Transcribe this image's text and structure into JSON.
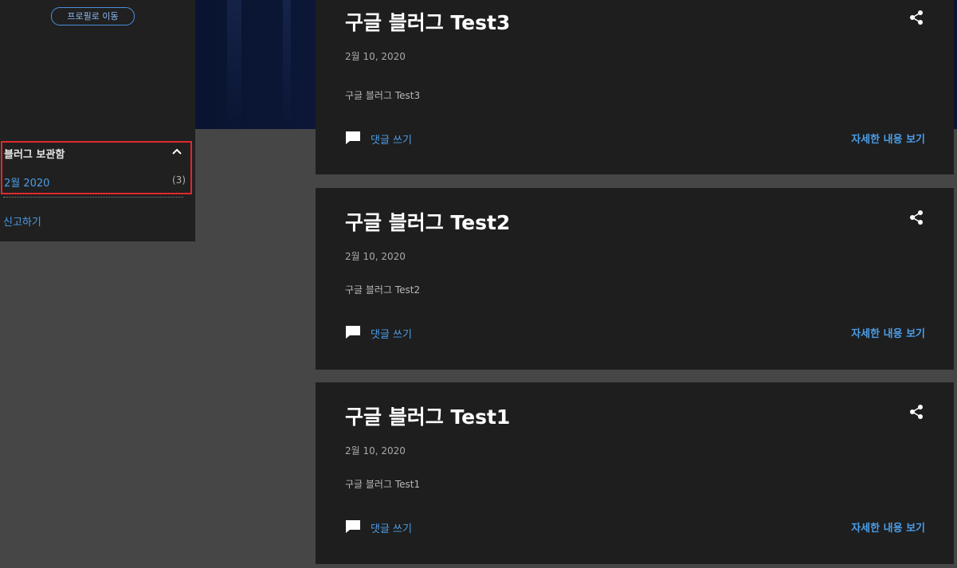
{
  "sidebar": {
    "profile_button": "프로필로 이동",
    "archive": {
      "title": "블러그 보관함",
      "month_link": "2월 2020",
      "count": "(3)"
    },
    "report_link": "신고하기"
  },
  "posts": [
    {
      "title": "구글 블러그 Test3",
      "date": "2월 10, 2020",
      "snippet": "구글 블러그 Test3",
      "comment_label": "댓글 쓰기",
      "read_more_label": "자세한 내용 보기"
    },
    {
      "title": "구글 블러그 Test2",
      "date": "2월 10, 2020",
      "snippet": "구글 블러그 Test2",
      "comment_label": "댓글 쓰기",
      "read_more_label": "자세한 내용 보기"
    },
    {
      "title": "구글 블러그 Test1",
      "date": "2월 10, 2020",
      "snippet": "구글 블러그 Test1",
      "comment_label": "댓글 쓰기",
      "read_more_label": "자세한 내용 보기"
    }
  ],
  "icons": {
    "share": "share-icon",
    "comment": "comment-icon",
    "collapse": "chevron-up-icon"
  },
  "colors": {
    "link": "#4a9de8",
    "highlight_border": "#e0282e"
  }
}
